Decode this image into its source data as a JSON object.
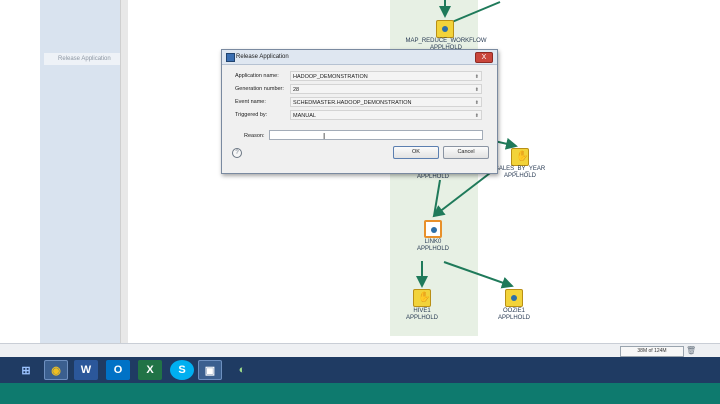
{
  "left_panel": {
    "selected_item": "Release Application"
  },
  "workflow": {
    "nodes": [
      {
        "name": "MAP_REDUCE_WORKFLOW",
        "status": "APPLHOLD"
      },
      {
        "name": "SALES_BY_YEAR",
        "status": "APPLHOLD"
      },
      {
        "name": "",
        "status": "APPLHOLD"
      },
      {
        "name": "LINK0",
        "status": "APPLHOLD"
      },
      {
        "name": "HIVE1",
        "status": "APPLHOLD"
      },
      {
        "name": "OOZIE1",
        "status": "APPLHOLD"
      }
    ]
  },
  "dialog": {
    "title": "Release Application",
    "close": "X",
    "fields": [
      {
        "label": "Application name:",
        "value": "HADOOP_DEMONSTRATION"
      },
      {
        "label": "Generation number:",
        "value": "28"
      },
      {
        "label": "Event name:",
        "value": "SCHEDMASTER.HADOOP_DEMONSTRATION"
      },
      {
        "label": "Triggered by:",
        "value": "MANUAL"
      }
    ],
    "reason_label": "Reason:",
    "reason_value": "",
    "help": "?",
    "ok_label": "OK",
    "cancel_label": "Cancel"
  },
  "status_bar": {
    "memory": "38M of 124M"
  },
  "taskbar": {
    "apps": [
      "windows-icon",
      "chrome-icon",
      "word-icon",
      "outlook-icon",
      "excel-icon",
      "skype-icon",
      "dialog-app-icon",
      "green-app-icon"
    ]
  },
  "colors": {
    "accent": "#1f7a5a",
    "taskbar": "#1f3b63",
    "lane": "#e7f0e4",
    "bottom_bar": "#0e7a6e"
  }
}
